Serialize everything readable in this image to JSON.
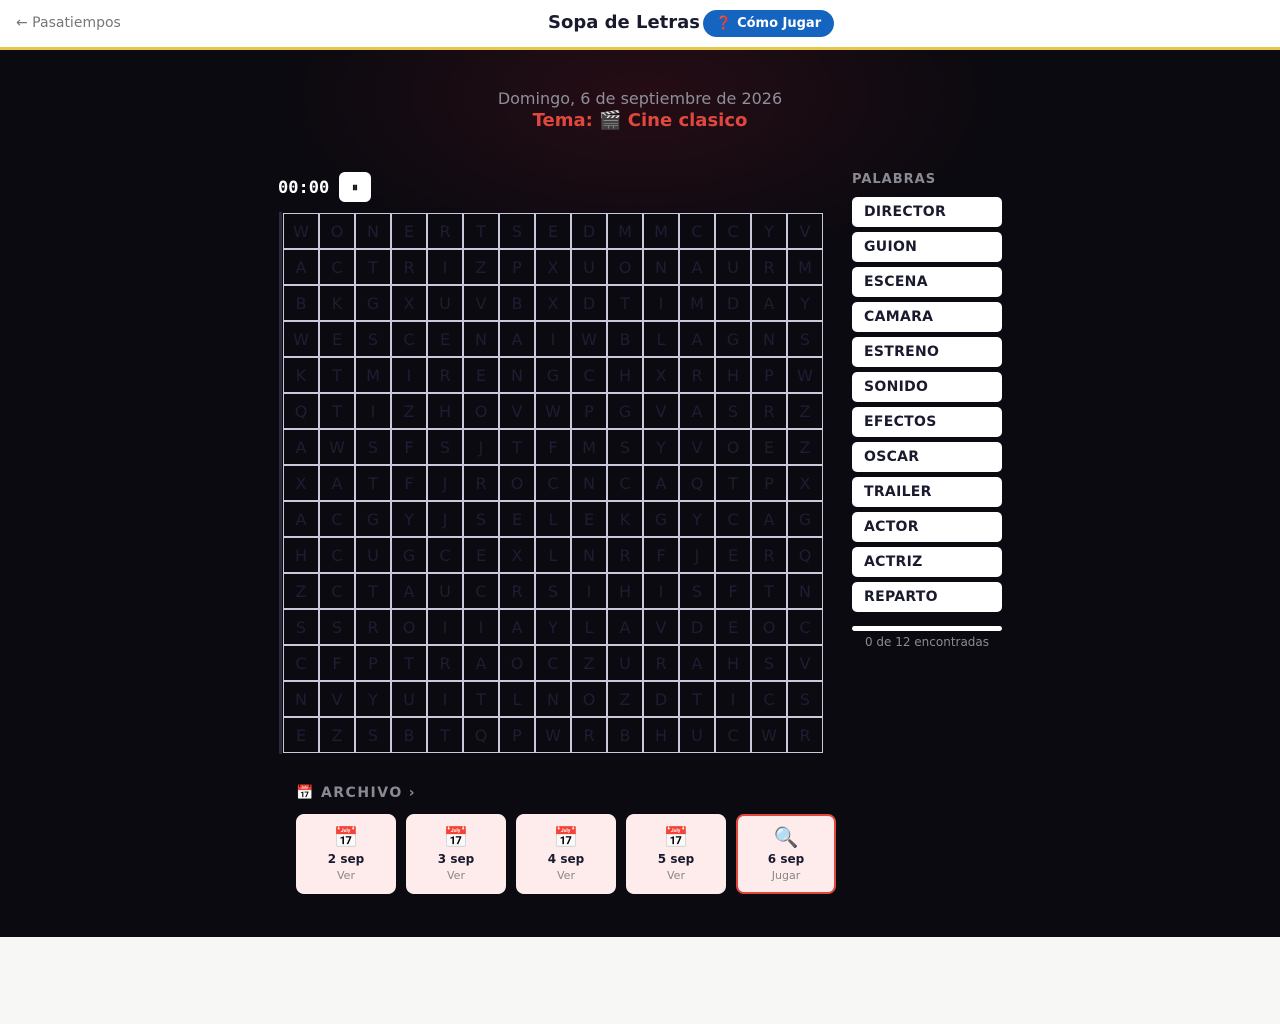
{
  "header": {
    "back_label": "← Pasatiempos",
    "title": "Sopa de Letras",
    "help_icon": "❓",
    "help_label": "Cómo Jugar"
  },
  "puzzle": {
    "date": "Domingo, 6 de septiembre de 2026",
    "theme": "Tema: 🎬 Cine clasico",
    "timer": "00:00",
    "pause_icon": "⏸",
    "grid": [
      "WONERTSEDMMCCYV",
      "ACTRIZPXUONAURM",
      "BKGXUVBXDTIMDAY",
      "WESCENAIWBLAGNS",
      "KTMIRENGCHXRHPW",
      "QTIZHOVWPGVASRZ",
      "AWSFSJTFMSYVOEZ",
      "XATFJROCNCAQTPX",
      "ACGYJSELEKGYCAG",
      "HCUGCEXLNRFJERQ",
      "ZCTAUCRSIHISFTN",
      "SSROIIAYLAVDEOC",
      "CFPTRAOCZURAHSV",
      "NVYUITLNOZDTICS",
      "EZSBTQPWRBHUCWR"
    ]
  },
  "words": {
    "title": "PALABRAS",
    "items": [
      "DIRECTOR",
      "GUION",
      "ESCENA",
      "CAMARA",
      "ESTRENO",
      "SONIDO",
      "EFECTOS",
      "OSCAR",
      "TRAILER",
      "ACTOR",
      "ACTRIZ",
      "REPARTO"
    ],
    "found_fraction": 0,
    "found_label": "0 de 12 encontradas"
  },
  "archive": {
    "icon": "📅",
    "title": "ARCHIVO",
    "chevron": "›",
    "days": [
      {
        "icon": "📅",
        "date": "2 sep",
        "action": "Ver"
      },
      {
        "icon": "📅",
        "date": "3 sep",
        "action": "Ver"
      },
      {
        "icon": "📅",
        "date": "4 sep",
        "action": "Ver"
      },
      {
        "icon": "📅",
        "date": "5 sep",
        "action": "Ver"
      },
      {
        "icon": "🔍",
        "date": "6 sep",
        "action": "Jugar"
      }
    ]
  },
  "colors": {
    "accent": "#e0483d",
    "header_line": "#e8c64a",
    "help_button": "#1565c0",
    "background": "#0b0a10"
  }
}
